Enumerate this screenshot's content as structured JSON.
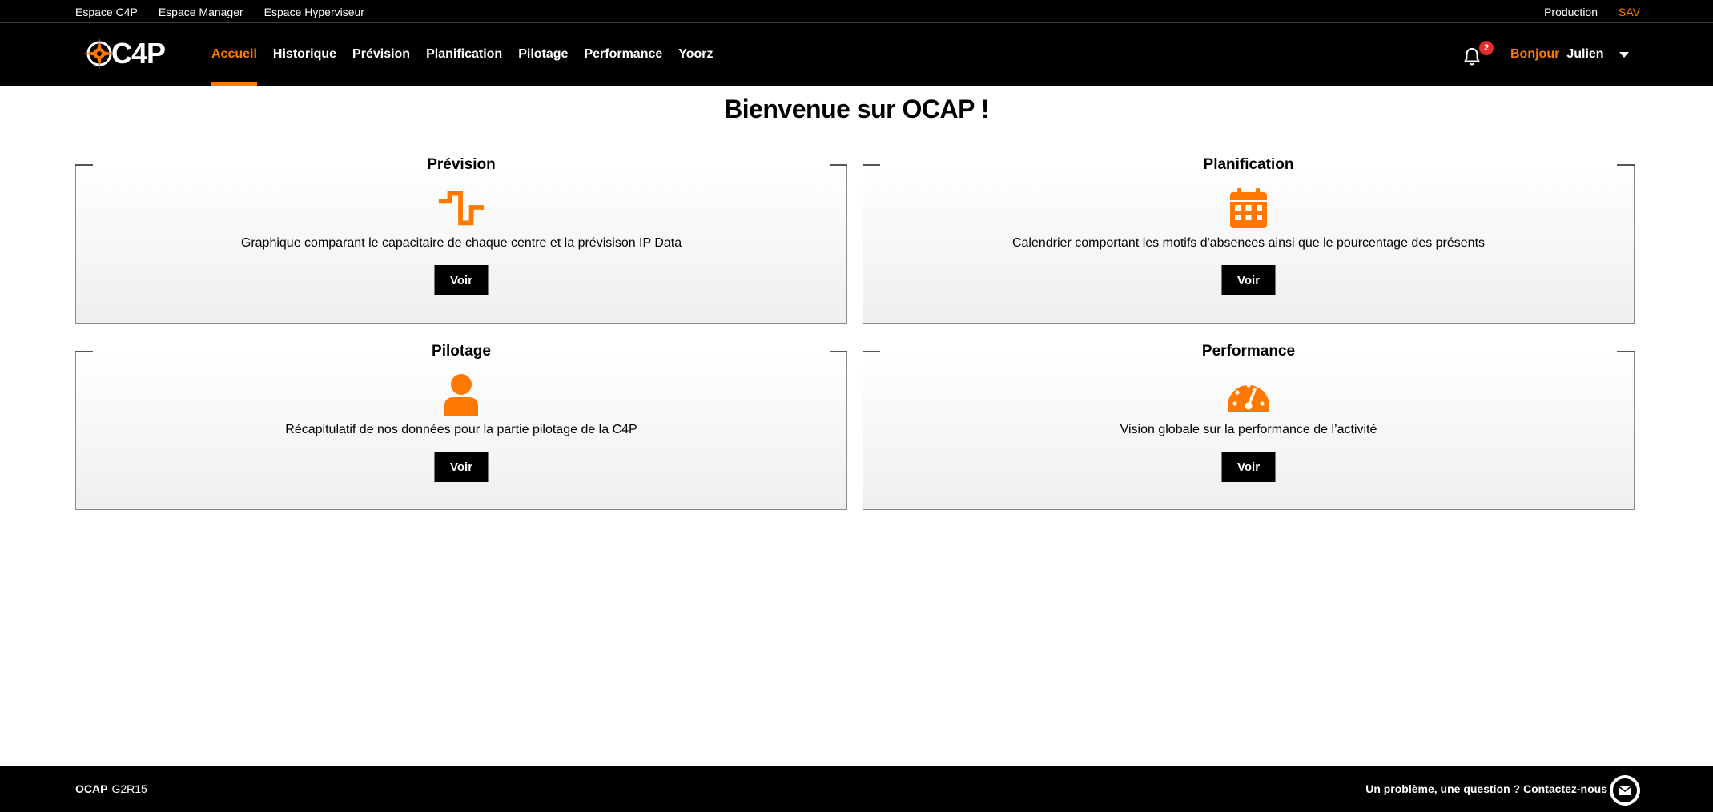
{
  "top_links": {
    "left": [
      "Espace C4P",
      "Espace Manager",
      "Espace Hyperviseur"
    ],
    "production": "Production",
    "sav": "SAV"
  },
  "logo": {
    "text_prefix": "C",
    "text_mid": "4",
    "text_suffix": "P"
  },
  "nav": {
    "items": [
      "Accueil",
      "Historique",
      "Prévision",
      "Planification",
      "Pilotage",
      "Performance",
      "Yoorz"
    ],
    "active": "Accueil"
  },
  "notifications": {
    "count": "2",
    "icon": "bell-icon"
  },
  "user": {
    "greeting": "Bonjour",
    "name": "Julien"
  },
  "page": {
    "title": "Bienvenue sur OCAP !"
  },
  "cards": [
    {
      "title": "Prévision",
      "icon": "signal-wave-icon",
      "description": "Graphique comparant le capacitaire de chaque centre et la prévisison IP Data",
      "button": "Voir"
    },
    {
      "title": "Planification",
      "icon": "calendar-icon",
      "description": "Calendrier comportant les motifs d'absences ainsi que le pourcentage des présents",
      "button": "Voir"
    },
    {
      "title": "Pilotage",
      "icon": "user-icon",
      "description": "Récapitulatif de nos données pour la partie pilotage de la C4P",
      "button": "Voir"
    },
    {
      "title": "Performance",
      "icon": "gauge-icon",
      "description": "Vision globale sur la performance de l’activité",
      "button": "Voir"
    }
  ],
  "footer": {
    "brand": "OCAP",
    "version": "G2R15",
    "contact": "Un problème, une question ? Contactez-nous",
    "icon": "mail-icon"
  },
  "colors": {
    "accent": "#ff7900",
    "dark": "#000000",
    "badge": "#e32c2c"
  }
}
